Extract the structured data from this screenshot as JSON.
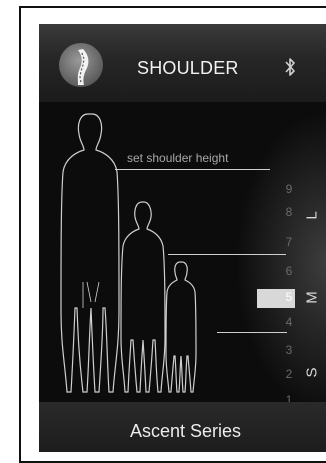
{
  "header": {
    "title": "SHOULDER",
    "logo_icon": "spine-logo-icon",
    "bluetooth_icon": "bluetooth-icon"
  },
  "panel": {
    "instruction": "set shoulder height",
    "scale": [
      "9",
      "8",
      "7",
      "6",
      "5",
      "4",
      "3",
      "2",
      "1"
    ],
    "selected_value": "5",
    "size_groups": {
      "large": "L",
      "medium": "M",
      "small": "S"
    }
  },
  "footer": {
    "series": "Ascent Series"
  },
  "colors": {
    "background": "#0a0a0a",
    "selection": "#d8d8d8",
    "text": "#f2f2f2"
  }
}
